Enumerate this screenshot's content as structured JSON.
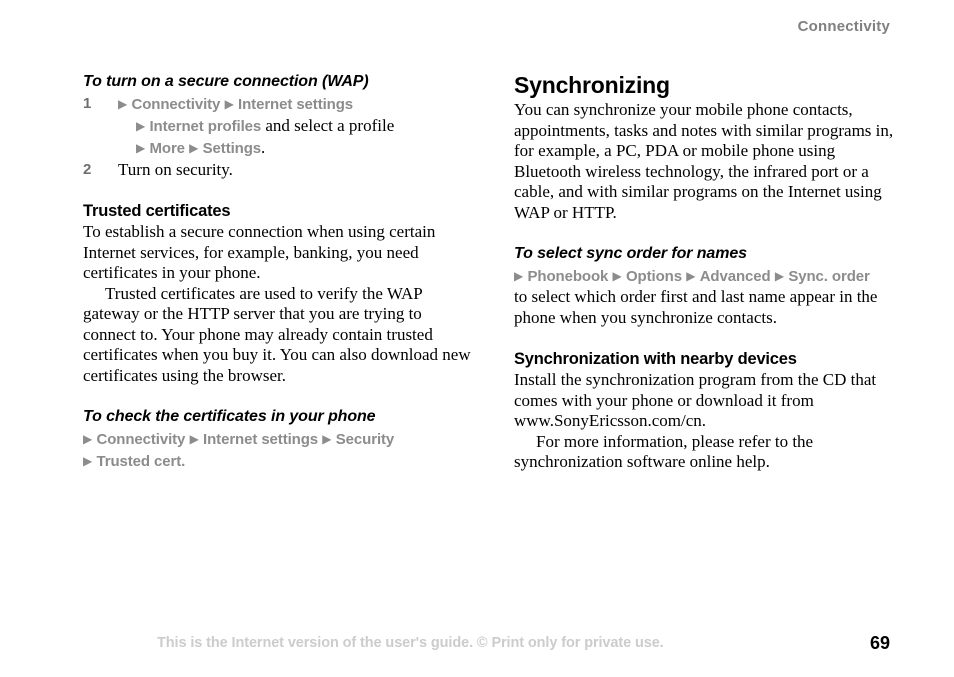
{
  "header": {
    "chapter": "Connectivity"
  },
  "left_column": {
    "procedure_wap": {
      "heading": "To turn on a secure connection (WAP)",
      "steps": [
        {
          "number": "1",
          "lines": [
            {
              "parts": [
                {
                  "type": "arrow",
                  "text": "▶"
                },
                {
                  "type": "menu",
                  "text": "Connectivity"
                },
                {
                  "type": "arrow",
                  "text": "▶"
                },
                {
                  "type": "menu",
                  "text": "Internet settings"
                }
              ]
            },
            {
              "parts": [
                {
                  "type": "arrow",
                  "text": "▶"
                },
                {
                  "type": "menu",
                  "text": "Internet profiles"
                },
                {
                  "type": "text",
                  "text": " and select a profile"
                }
              ]
            },
            {
              "parts": [
                {
                  "type": "arrow",
                  "text": "▶"
                },
                {
                  "type": "menu",
                  "text": "More"
                },
                {
                  "type": "arrow",
                  "text": "▶"
                },
                {
                  "type": "menu",
                  "text": "Settings"
                },
                {
                  "type": "text",
                  "text": "."
                }
              ]
            }
          ]
        },
        {
          "number": "2",
          "lines": [
            {
              "parts": [
                {
                  "type": "text",
                  "text": "Turn on security."
                }
              ]
            }
          ]
        }
      ]
    },
    "trusted_certificates": {
      "heading": "Trusted certificates",
      "paragraph_1": "To establish a secure connection when using certain Internet services, for example, banking, you need certificates in your phone.",
      "paragraph_2": "Trusted certificates are used to verify the WAP gateway or the HTTP server that you are trying to connect to. Your phone may already contain trusted certificates when you buy it. You can also download new certificates using the browser."
    },
    "procedure_check_certificates": {
      "heading": "To check the certificates in your phone",
      "path_lines": [
        {
          "parts": [
            {
              "type": "arrow",
              "text": "▶"
            },
            {
              "type": "menu",
              "text": "Connectivity"
            },
            {
              "type": "arrow",
              "text": "▶"
            },
            {
              "type": "menu",
              "text": "Internet settings"
            },
            {
              "type": "arrow",
              "text": "▶"
            },
            {
              "type": "menu",
              "text": "Security"
            }
          ]
        },
        {
          "parts": [
            {
              "type": "arrow",
              "text": "▶"
            },
            {
              "type": "menu",
              "text": "Trusted cert."
            }
          ]
        }
      ]
    }
  },
  "right_column": {
    "synchronizing": {
      "heading": "Synchronizing",
      "paragraph_1": "You can synchronize your mobile phone contacts, appointments, tasks and notes with similar programs in, for example, a PC, PDA or mobile phone using Bluetooth wireless technology, the infrared port or a cable, and with similar programs on the Internet using WAP or HTTP."
    },
    "procedure_sync_order": {
      "heading": "To select sync order for names",
      "path_line": {
        "parts": [
          {
            "type": "arrow",
            "text": "▶"
          },
          {
            "type": "menu",
            "text": "Phonebook"
          },
          {
            "type": "arrow",
            "text": "▶"
          },
          {
            "type": "menu",
            "text": "Options"
          },
          {
            "type": "arrow",
            "text": "▶"
          },
          {
            "type": "menu",
            "text": "Advanced"
          },
          {
            "type": "arrow",
            "text": "▶"
          },
          {
            "type": "menu",
            "text": "Sync. order"
          }
        ]
      },
      "paragraph_1": "to select which order first and last name appear in the phone when you synchronize contacts."
    },
    "sync_nearby_devices": {
      "heading": "Synchronization with nearby devices",
      "paragraph_1": "Install the synchronization program from the CD that comes with your phone or download it from www.SonyEricsson.com/cn.",
      "paragraph_2": "For more information, please refer to the synchronization software online help."
    }
  },
  "footer": {
    "note": "This is the Internet version of the user's guide. © Print only for private use.",
    "page_number": "69"
  }
}
